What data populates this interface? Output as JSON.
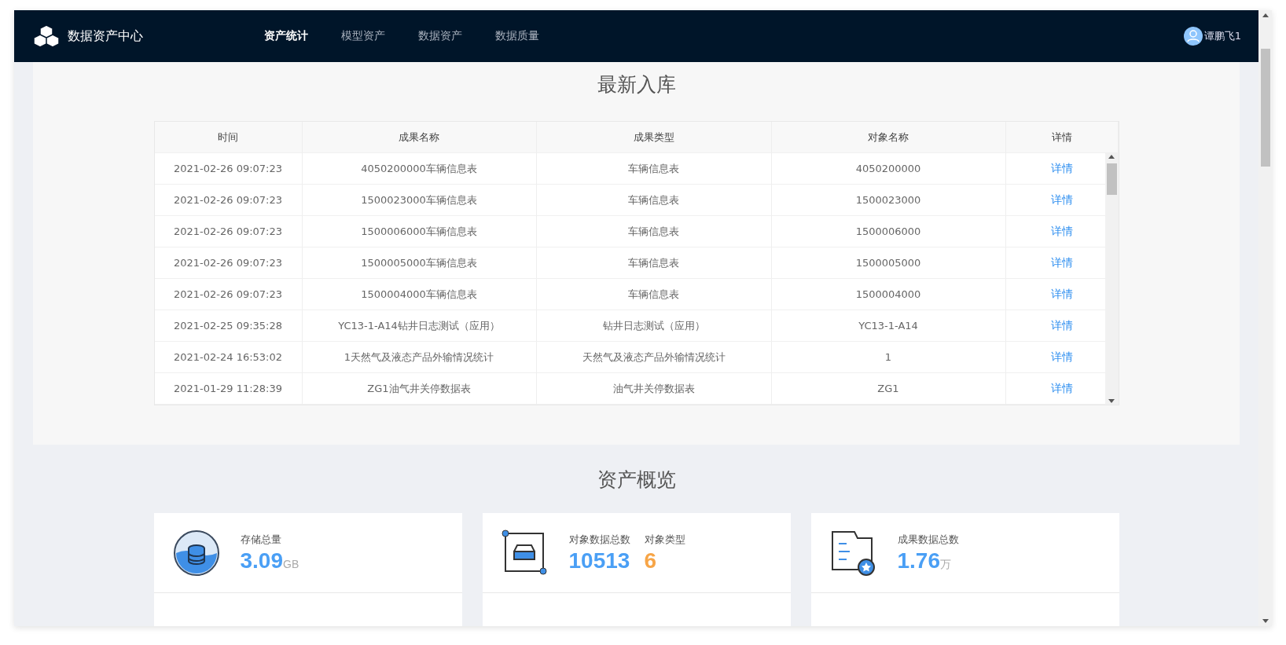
{
  "header": {
    "logo_text": "数据资产中心",
    "nav": [
      {
        "label": "资产统计",
        "selected": true
      },
      {
        "label": "模型资产",
        "selected": false
      },
      {
        "label": "数据资产",
        "selected": false
      },
      {
        "label": "数据质量",
        "selected": false
      }
    ],
    "user": "谭鹏飞1"
  },
  "latest": {
    "title": "最新入库",
    "columns": [
      "时间",
      "成果名称",
      "成果类型",
      "对象名称",
      "详情"
    ],
    "rows": [
      [
        "2021-02-26 09:07:23",
        "4050200000车辆信息表",
        "车辆信息表",
        "4050200000",
        "详情"
      ],
      [
        "2021-02-26 09:07:23",
        "1500023000车辆信息表",
        "车辆信息表",
        "1500023000",
        "详情"
      ],
      [
        "2021-02-26 09:07:23",
        "1500006000车辆信息表",
        "车辆信息表",
        "1500006000",
        "详情"
      ],
      [
        "2021-02-26 09:07:23",
        "1500005000车辆信息表",
        "车辆信息表",
        "1500005000",
        "详情"
      ],
      [
        "2021-02-26 09:07:23",
        "1500004000车辆信息表",
        "车辆信息表",
        "1500004000",
        "详情"
      ],
      [
        "2021-02-25 09:35:28",
        "YC13-1-A14钻井日志测试（应用）",
        "钻井日志测试（应用）",
        "YC13-1-A14",
        "详情"
      ],
      [
        "2021-02-24 16:53:02",
        "1天然气及液态产品外输情况统计",
        "天然气及液态产品外输情况统计",
        "1",
        "详情"
      ],
      [
        "2021-01-29 11:28:39",
        "ZG1油气井关停数据表",
        "油气井关停数据表",
        "ZG1",
        "详情"
      ]
    ]
  },
  "overview": {
    "title": "资产概览",
    "cards": [
      {
        "kind": "storage",
        "stats": [
          {
            "label": "存储总量",
            "value": "3.09",
            "unit": "GB",
            "color": "#4a9ff5"
          }
        ]
      },
      {
        "kind": "objects",
        "stats": [
          {
            "label": "对象数据总数",
            "value": "10513",
            "color": "#4a9ff5"
          },
          {
            "label": "对象类型",
            "value": "6",
            "color": "#f7a547"
          }
        ]
      },
      {
        "kind": "results",
        "stats": [
          {
            "label": "成果数据总数",
            "value": "1.76",
            "unit": "万",
            "color": "#4a9ff5"
          }
        ]
      }
    ]
  }
}
